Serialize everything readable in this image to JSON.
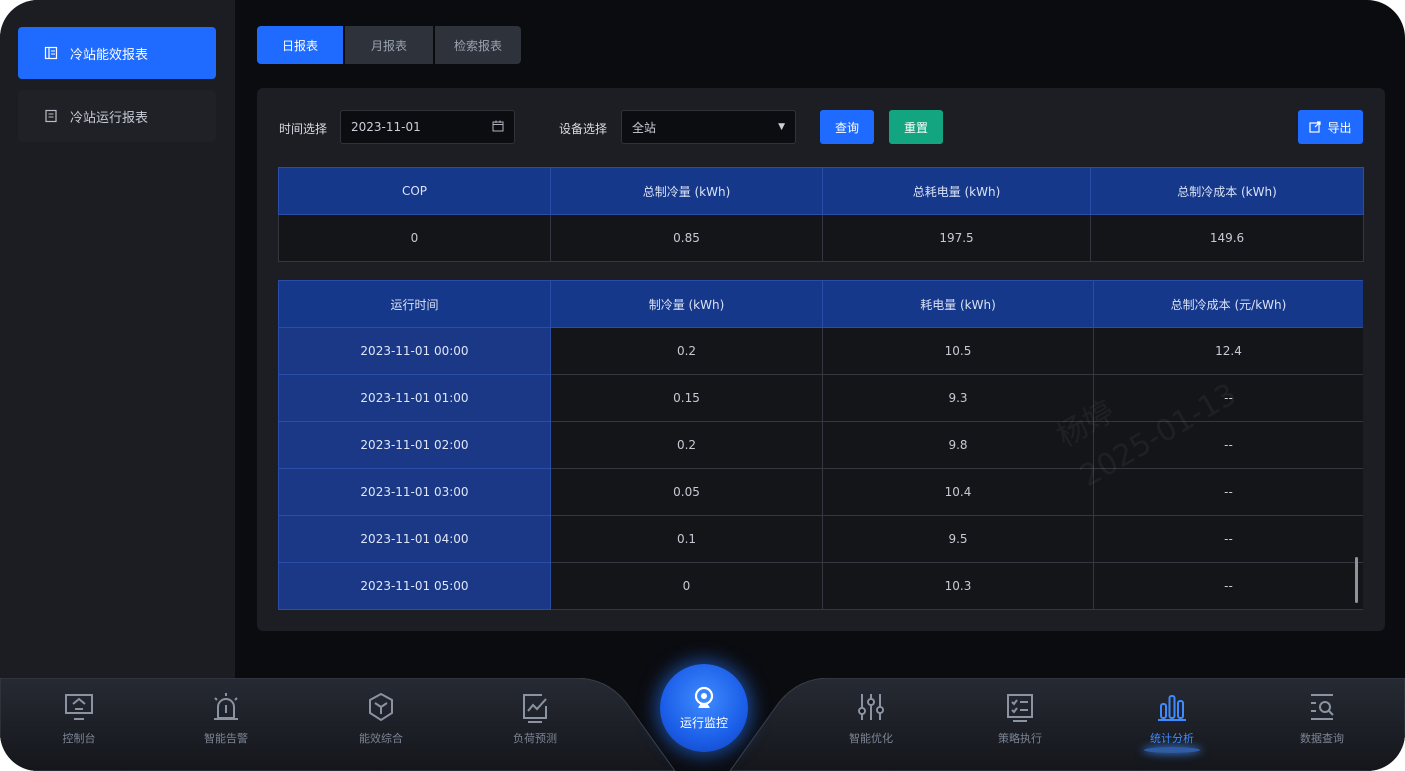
{
  "sidebar": {
    "items": [
      {
        "label": "冷站能效报表",
        "icon": "report-icon",
        "active": true
      },
      {
        "label": "冷站运行报表",
        "icon": "document-icon",
        "active": false
      }
    ]
  },
  "tabs": [
    {
      "label": "日报表",
      "active": true
    },
    {
      "label": "月报表",
      "active": false
    },
    {
      "label": "检索报表",
      "active": false
    }
  ],
  "filters": {
    "time_label": "时间选择",
    "date_value": "2023-11-01",
    "device_label": "设备选择",
    "device_value": "全站",
    "query_button": "查询",
    "reset_button": "重置",
    "export_button": "导出"
  },
  "summary_table": {
    "headers": [
      "COP",
      "总制冷量 (kWh)",
      "总耗电量 (kWh)",
      "总制冷成本 (kWh)"
    ],
    "row": [
      "0",
      "0.85",
      "197.5",
      "149.6"
    ]
  },
  "detail_table": {
    "headers": [
      "运行时间",
      "制冷量 (kWh)",
      "耗电量 (kWh)",
      "总制冷成本 (元/kWh)"
    ],
    "rows": [
      [
        "2023-11-01 00:00",
        "0.2",
        "10.5",
        "12.4"
      ],
      [
        "2023-11-01 01:00",
        "0.15",
        "9.3",
        "--"
      ],
      [
        "2023-11-01 02:00",
        "0.2",
        "9.8",
        "--"
      ],
      [
        "2023-11-01 03:00",
        "0.05",
        "10.4",
        "--"
      ],
      [
        "2023-11-01 04:00",
        "0.1",
        "9.5",
        "--"
      ],
      [
        "2023-11-01 05:00",
        "0",
        "10.3",
        "--"
      ]
    ]
  },
  "watermark": {
    "line1": "杨婷",
    "line2": "2025-01-13"
  },
  "bottom_nav": {
    "items": [
      {
        "label": "控制台",
        "icon": "monitor-icon"
      },
      {
        "label": "智能告警",
        "icon": "alarm-icon"
      },
      {
        "label": "能效综合",
        "icon": "cube-icon"
      },
      {
        "label": "负荷预测",
        "icon": "chart-icon"
      },
      {
        "label": "智能优化",
        "icon": "sliders-icon"
      },
      {
        "label": "策略执行",
        "icon": "checklist-icon"
      },
      {
        "label": "统计分析",
        "icon": "bar-chart-icon",
        "active": true
      },
      {
        "label": "数据查询",
        "icon": "search-icon"
      }
    ],
    "center": {
      "label": "运行监控",
      "icon": "webcam-icon"
    }
  },
  "colors": {
    "accent": "#1f6bff",
    "reset": "#13a57f",
    "header_blue": "#16388a"
  }
}
